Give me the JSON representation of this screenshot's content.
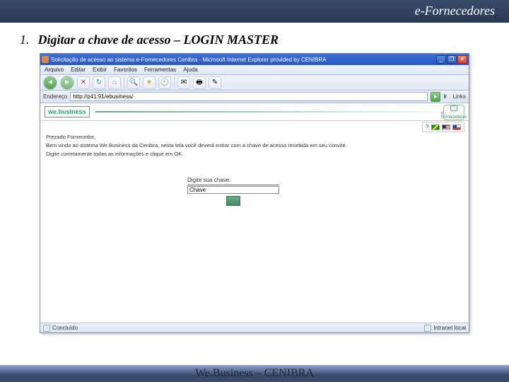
{
  "slide": {
    "header_title": "e-Fornecedores",
    "step_number": "1.",
    "step_text": "Digitar  a chave de acesso – LOGIN MASTER",
    "footer": "We.Business – CENIBRA"
  },
  "ie": {
    "window_title": "Solicitação de acesso ao sistema e-Fornecedores Cenibra - Microsoft Internet Explorer provided by CENIBRA",
    "menu": {
      "file": "Arquivo",
      "edit": "Editar",
      "view": "Exibir",
      "fav": "Favoritos",
      "tools": "Ferramentas",
      "help": "Ajuda"
    },
    "address_label": "Endereço",
    "address_value": "http://p41:91/ebusiness/",
    "go_label": "Ir",
    "links_label": "Links",
    "status_left": "Concluído",
    "status_right": "Intranet local",
    "win": {
      "min": "_",
      "max": "❐",
      "close": "✕"
    },
    "tb": {
      "back": "◄",
      "fwd": "►",
      "stop": "✕",
      "refresh": "↻",
      "home": "⌂",
      "search": "🔍",
      "fav": "★",
      "hist": "🕘",
      "mail": "✉",
      "print": "🖶",
      "edit": "✎"
    }
  },
  "page": {
    "logo_text": "we.business",
    "forn_label": "e-Fornecedores",
    "greeting": "Prezado Fornecedor,",
    "welcome": "Bem vindo ao sistema We.Business da Cenibra, nesta tela você deverá entrar com a chave de acesso recebida em seu convite.",
    "instruct": "Digite corretamente todas as informações e clique em OK.",
    "login_label": "Digite sua chave:",
    "login_value": "Chave",
    "help_glyph": "?"
  }
}
